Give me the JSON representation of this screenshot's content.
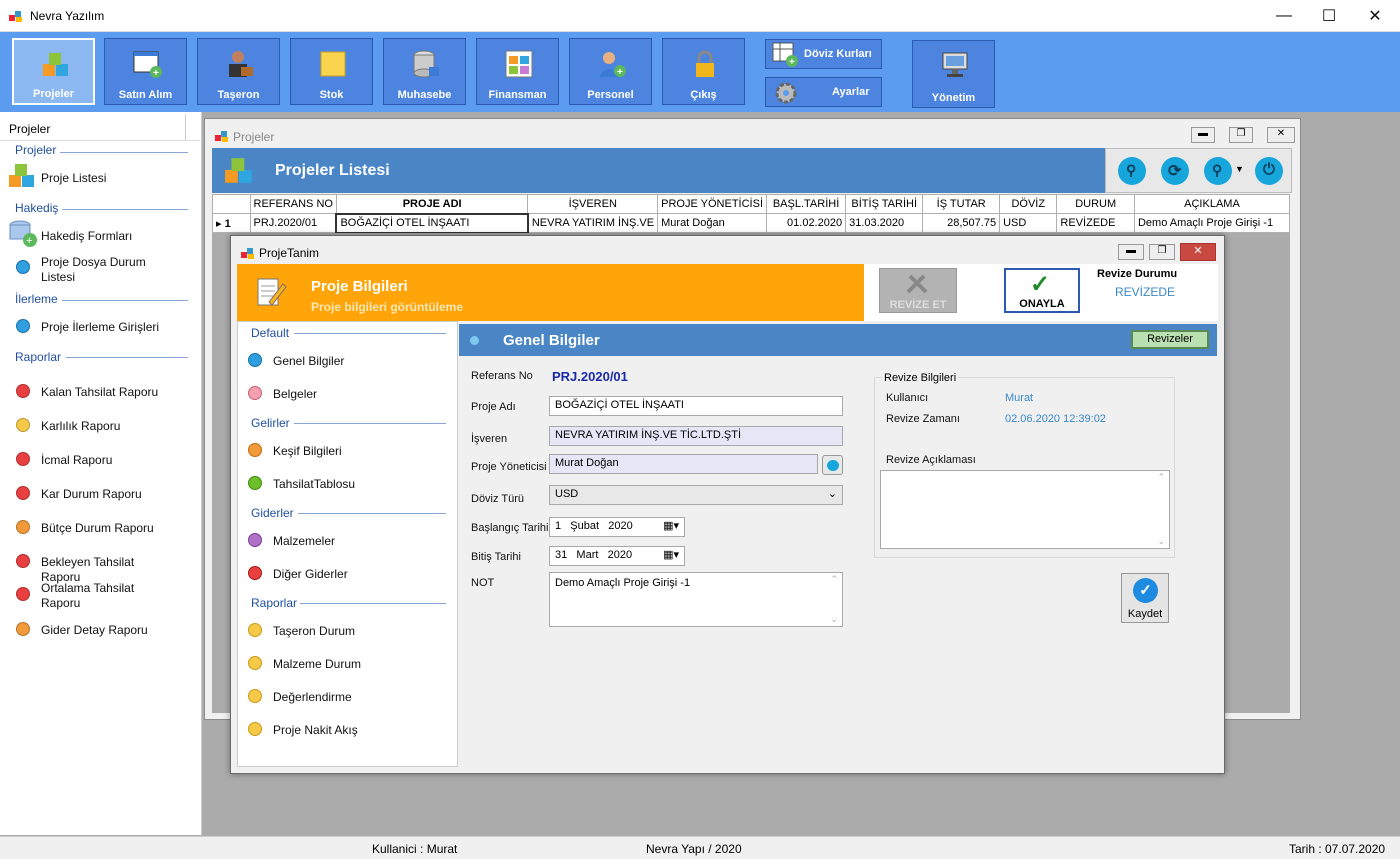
{
  "app": {
    "title": "Nevra Yazılım"
  },
  "ribbon": {
    "buttons": [
      "Projeler",
      "Satın Alım",
      "Taşeron",
      "Stok",
      "Muhasebe",
      "Finansman",
      "Personel",
      "Çıkış"
    ],
    "doviz": "Döviz Kurları",
    "ayarlar": "Ayarlar",
    "yonetim": "Yönetim"
  },
  "sidebar": {
    "title": "Projeler",
    "groups": {
      "projeler": "Projeler",
      "hakedis": "Hakediş",
      "ilerleme": "İlerleme",
      "raporlar": "Raporlar"
    },
    "items": {
      "proje_listesi": "Proje Listesi",
      "hakedis_formlari": "Hakediş Formları",
      "dosya_durum": "Proje Dosya Durum Listesi",
      "ilerleme_giris": "Proje İlerleme Girişleri",
      "reports": [
        "Kalan Tahsilat Raporu",
        "Karlılık Raporu",
        "İcmal Raporu",
        "Kar Durum Raporu",
        "Bütçe Durum Raporu",
        "Bekleyen Tahsilat Raporu",
        "Ortalama Tahsilat Raporu",
        "Gider Detay Raporu"
      ]
    },
    "report_colors": [
      "#e84040",
      "#f7c948",
      "#e84040",
      "#e84040",
      "#f29a3a",
      "#e84040",
      "#e84040",
      "#f29a3a"
    ]
  },
  "projwin": {
    "title": "Projeler",
    "header": "Projeler Listesi",
    "columns": [
      "REFERANS NO",
      "PROJE ADI",
      "İŞVEREN",
      "PROJE YÖNETİCİSİ",
      "BAŞL.TARİHİ",
      "BİTİŞ TARİHİ",
      "İŞ TUTAR",
      "DÖVİZ",
      "DURUM",
      "AÇIKLAMA"
    ],
    "row": {
      "num": "1",
      "cells": [
        "PRJ.2020/01",
        "BOĞAZİÇİ OTEL İNŞAATI",
        "NEVRA YATIRIM İNŞ.VE",
        "Murat Doğan",
        "01.02.2020",
        "31.03.2020",
        "28,507.75",
        "USD",
        "REVİZEDE",
        "Demo Amaçlı Proje Girişi -1"
      ]
    }
  },
  "dialog": {
    "title": "ProjeTanim",
    "header_title": "Proje Bilgileri",
    "header_sub": "Proje bilgileri görüntüleme",
    "revize_et": "REVİZE ET",
    "onayla": "ONAYLA",
    "revize_durumu_label": "Revize Durumu",
    "revize_durumu_value": "REVİZEDE",
    "left": {
      "default": "Default",
      "genel": "Genel Bilgiler",
      "belgeler": "Belgeler",
      "gelirler": "Gelirler",
      "kesif": "Keşif Bilgileri",
      "tahsilat": "TahsilatTablosu",
      "giderler": "Giderler",
      "malzemeler": "Malzemeler",
      "diger": "Diğer Giderler",
      "raporlar": "Raporlar",
      "taseron": "Taşeron Durum",
      "malzeme_durum": "Malzeme Durum",
      "degerlendirme": "Değerlendirme",
      "nakit": "Proje Nakit Akış"
    },
    "section": "Genel Bilgiler",
    "revizeler": "Revizeler",
    "form": {
      "ref_label": "Referans No",
      "ref_value": "PRJ.2020/01",
      "ad_label": "Proje Adı",
      "ad_value": "BOĞAZİÇİ OTEL İNŞAATI",
      "isveren_label": "İşveren",
      "isveren_value": "NEVRA YATIRIM İNŞ.VE TİC.LTD.ŞTİ",
      "yonetici_label": "Proje Yöneticisi",
      "yonetici_value": "Murat Doğan",
      "doviz_label": "Döviz Türü",
      "doviz_value": "USD",
      "bas_label": "Başlangıç Tarihi",
      "bas_day": "1",
      "bas_month": "Şubat",
      "bas_year": "2020",
      "bit_label": "Bitiş Tarihi",
      "bit_day": "31",
      "bit_month": "Mart",
      "bit_year": "2020",
      "not_label": "NOT",
      "not_value": "Demo Amaçlı Proje Girişi -1"
    },
    "revize": {
      "group": "Revize Bilgileri",
      "kullanici_label": "Kullanıcı",
      "kullanici_value": "Murat",
      "zaman_label": "Revize Zamanı",
      "zaman_value": "02.06.2020 12:39:02",
      "aciklama_label": "Revize Açıklaması"
    },
    "kaydet": "Kaydet"
  },
  "status": {
    "user": "Kullanici : Murat",
    "center": "Nevra Yapı / 2020",
    "date": "Tarih : 07.07.2020"
  }
}
